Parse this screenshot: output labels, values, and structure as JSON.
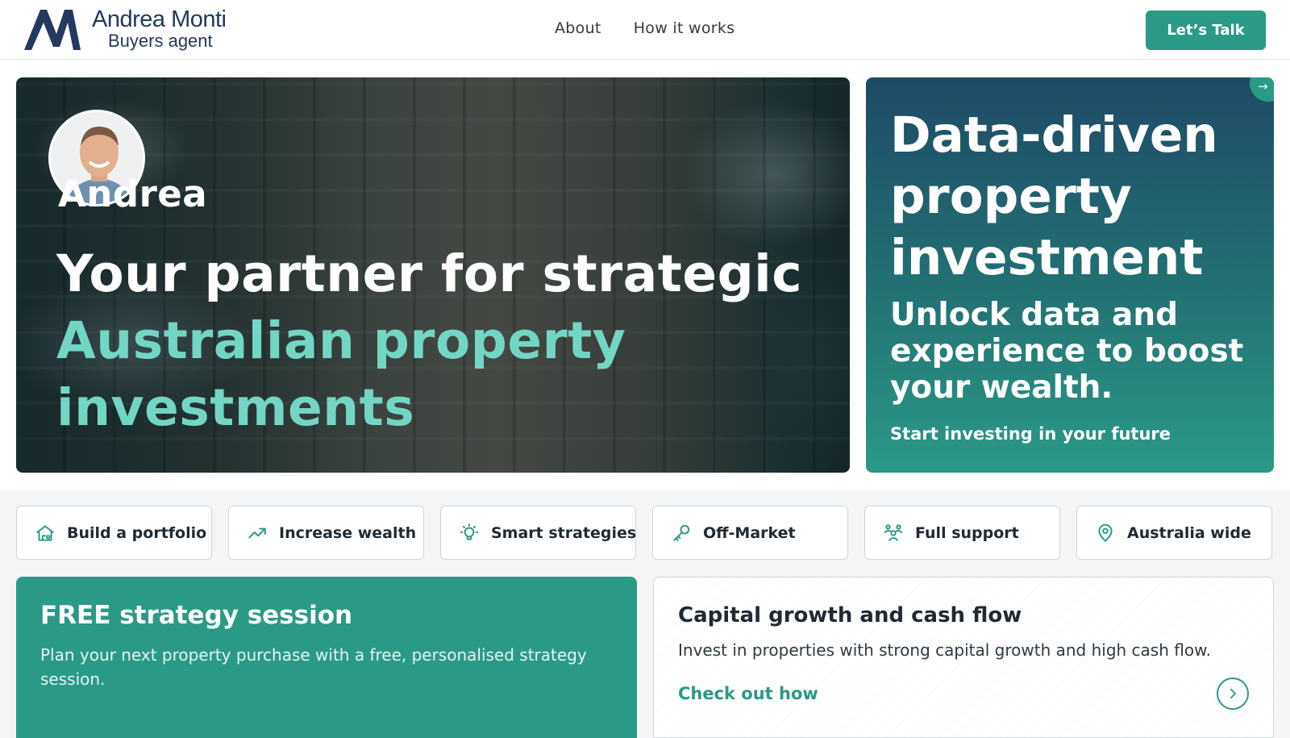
{
  "header": {
    "logo_name": "Andrea Monti",
    "logo_subtitle": "Buyers agent",
    "nav": [
      {
        "label": "About"
      },
      {
        "label": "How it works"
      }
    ],
    "cta_label": "Let’s Talk"
  },
  "hero": {
    "name": "Andrea",
    "title_line1": "Your partner for strategic",
    "title_accent": "Australian property investments",
    "card": {
      "title": "Data-driven property investment",
      "subtitle": "Unlock data and experience to boost your wealth.",
      "link": "Start investing in your future",
      "corner_icon": "arrow-right-icon"
    }
  },
  "features": [
    {
      "label": "Build a portfolio",
      "icon": "house-icon"
    },
    {
      "label": "Increase wealth",
      "icon": "trending-up-icon"
    },
    {
      "label": "Smart strategies",
      "icon": "lightbulb-icon"
    },
    {
      "label": "Off-Market",
      "icon": "key-icon"
    },
    {
      "label": "Full support",
      "icon": "people-icon"
    },
    {
      "label": "Australia wide",
      "icon": "map-pin-icon"
    }
  ],
  "promo": {
    "title": "FREE strategy session",
    "text": "Plan your next property purchase with a free, personalised strategy session."
  },
  "growth": {
    "title": "Capital growth and cash flow",
    "text": "Invest in properties with strong capital growth and high cash flow.",
    "link": "Check out how"
  },
  "colors": {
    "brand_navy": "#23395d",
    "brand_teal": "#2a9a87",
    "accent_mint": "#73d6c5"
  }
}
